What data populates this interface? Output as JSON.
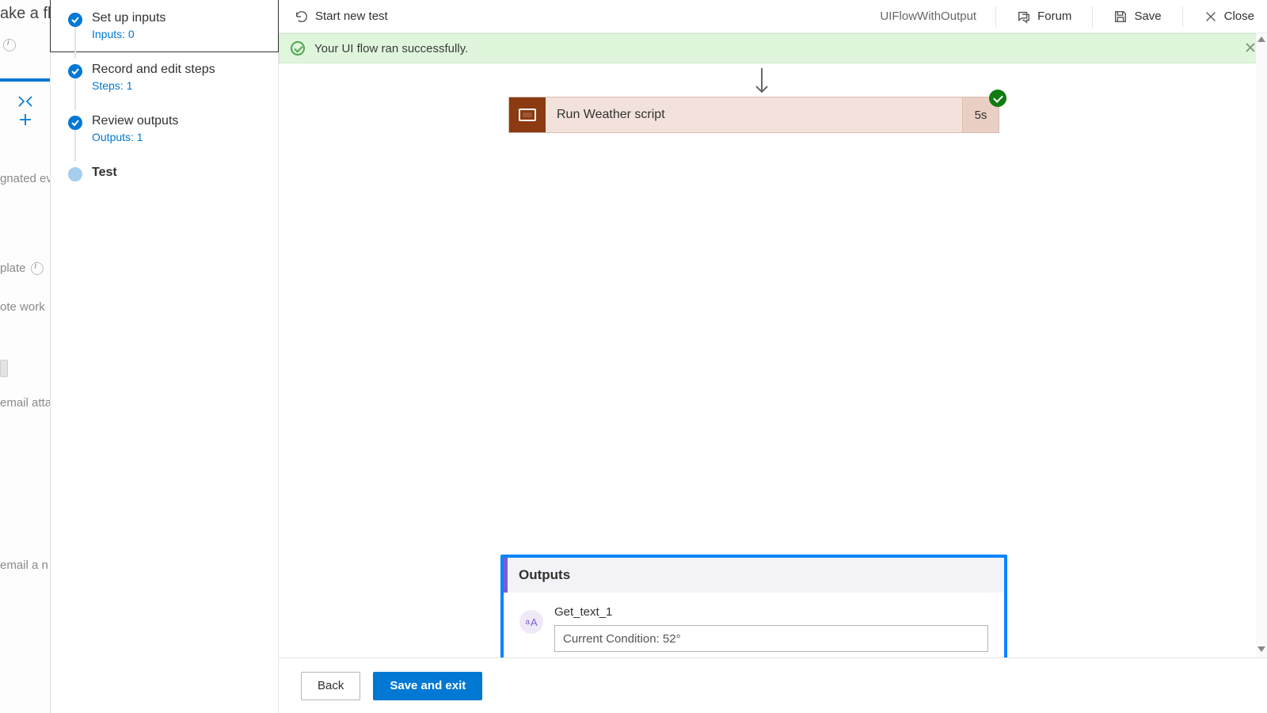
{
  "ghost": {
    "title_fragment": "ake a fl",
    "frag1": "gnated even",
    "frag2": "plate",
    "frag3": "ote work",
    "frag4": "email attac",
    "frag5": "email a n"
  },
  "steps": [
    {
      "label": "Set up inputs",
      "sub": "Inputs: 0",
      "done": true,
      "selected": true
    },
    {
      "label": "Record and edit steps",
      "sub": "Steps: 1",
      "done": true,
      "selected": false
    },
    {
      "label": "Review outputs",
      "sub": "Outputs: 1",
      "done": true,
      "selected": false
    },
    {
      "label": "Test",
      "sub": "",
      "done": false,
      "selected": false,
      "bold": true
    }
  ],
  "toolbar": {
    "start_new_test": "Start new test",
    "flow_name": "UIFlowWithOutput",
    "forum": "Forum",
    "save": "Save",
    "close": "Close"
  },
  "banner": {
    "text": "Your UI flow ran successfully."
  },
  "action": {
    "title": "Run Weather script",
    "duration": "5s"
  },
  "outputs": {
    "heading": "Outputs",
    "item_label": "Get_text_1",
    "item_value": "Current Condition: 52°"
  },
  "footer": {
    "back": "Back",
    "save_exit": "Save and exit"
  }
}
